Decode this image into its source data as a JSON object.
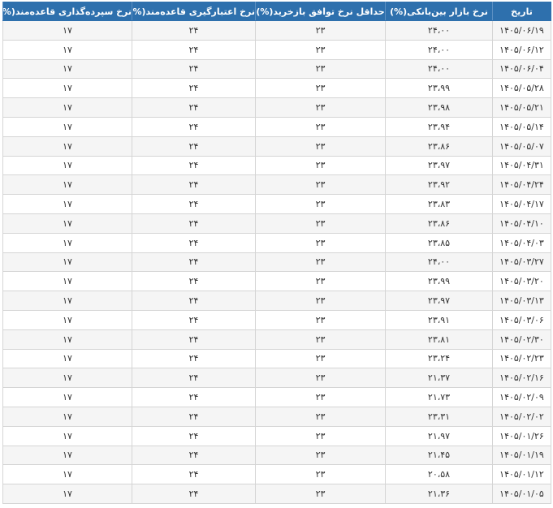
{
  "table": {
    "headers": [
      "تاریخ",
      "نرخ بازار بین‌بانکی(%)",
      "حداقل نرخ توافق بازخرید(%)",
      "نرخ اعتبارگیری قاعده‌مند(%)",
      "نرخ سپرده‌گذاری قاعده‌مند(%)"
    ],
    "rows": [
      [
        "۱۴۰۵/۰۶/۱۹",
        "۲۴،۰۰",
        "۲۳",
        "۲۴",
        "۱۷"
      ],
      [
        "۱۴۰۵/۰۶/۱۲",
        "۲۴،۰۰",
        "۲۳",
        "۲۴",
        "۱۷"
      ],
      [
        "۱۴۰۵/۰۶/۰۴",
        "۲۴،۰۰",
        "۲۳",
        "۲۴",
        "۱۷"
      ],
      [
        "۱۴۰۵/۰۵/۲۸",
        "۲۳،۹۹",
        "۲۳",
        "۲۴",
        "۱۷"
      ],
      [
        "۱۴۰۵/۰۵/۲۱",
        "۲۳،۹۸",
        "۲۳",
        "۲۴",
        "۱۷"
      ],
      [
        "۱۴۰۵/۰۵/۱۴",
        "۲۳،۹۴",
        "۲۳",
        "۲۴",
        "۱۷"
      ],
      [
        "۱۴۰۵/۰۵/۰۷",
        "۲۳،۸۶",
        "۲۳",
        "۲۴",
        "۱۷"
      ],
      [
        "۱۴۰۵/۰۴/۳۱",
        "۲۳،۹۷",
        "۲۳",
        "۲۴",
        "۱۷"
      ],
      [
        "۱۴۰۵/۰۴/۲۴",
        "۲۳،۹۲",
        "۲۳",
        "۲۴",
        "۱۷"
      ],
      [
        "۱۴۰۵/۰۴/۱۷",
        "۲۳،۸۳",
        "۲۳",
        "۲۴",
        "۱۷"
      ],
      [
        "۱۴۰۵/۰۴/۱۰",
        "۲۳،۸۶",
        "۲۳",
        "۲۴",
        "۱۷"
      ],
      [
        "۱۴۰۵/۰۴/۰۳",
        "۲۳،۸۵",
        "۲۳",
        "۲۴",
        "۱۷"
      ],
      [
        "۱۴۰۵/۰۳/۲۷",
        "۲۴،۰۰",
        "۲۳",
        "۲۴",
        "۱۷"
      ],
      [
        "۱۴۰۵/۰۳/۲۰",
        "۲۳،۹۹",
        "۲۳",
        "۲۴",
        "۱۷"
      ],
      [
        "۱۴۰۵/۰۳/۱۳",
        "۲۳،۹۷",
        "۲۳",
        "۲۴",
        "۱۷"
      ],
      [
        "۱۴۰۵/۰۳/۰۶",
        "۲۳،۹۱",
        "۲۳",
        "۲۴",
        "۱۷"
      ],
      [
        "۱۴۰۵/۰۲/۳۰",
        "۲۳،۸۱",
        "۲۳",
        "۲۴",
        "۱۷"
      ],
      [
        "۱۴۰۵/۰۲/۲۳",
        "۲۳،۲۴",
        "۲۳",
        "۲۴",
        "۱۷"
      ],
      [
        "۱۴۰۵/۰۲/۱۶",
        "۲۱،۳۷",
        "۲۳",
        "۲۴",
        "۱۷"
      ],
      [
        "۱۴۰۵/۰۲/۰۹",
        "۲۱،۷۳",
        "۲۳",
        "۲۴",
        "۱۷"
      ],
      [
        "۱۴۰۵/۰۲/۰۲",
        "۲۳،۳۱",
        "۲۳",
        "۲۴",
        "۱۷"
      ],
      [
        "۱۴۰۵/۰۱/۲۶",
        "۲۱،۹۷",
        "۲۳",
        "۲۴",
        "۱۷"
      ],
      [
        "۱۴۰۵/۰۱/۱۹",
        "۲۱،۴۵",
        "۲۳",
        "۲۴",
        "۱۷"
      ],
      [
        "۱۴۰۵/۰۱/۱۲",
        "۲۰،۵۸",
        "۲۳",
        "۲۴",
        "۱۷"
      ],
      [
        "۱۴۰۵/۰۱/۰۵",
        "۲۱،۳۶",
        "۲۳",
        "۲۴",
        "۱۷"
      ]
    ]
  },
  "colors": {
    "header_bg": "#2e70ad",
    "header_text": "#ffffff",
    "row_alt_bg": "#f5f5f5",
    "border": "#d5d5d5"
  }
}
